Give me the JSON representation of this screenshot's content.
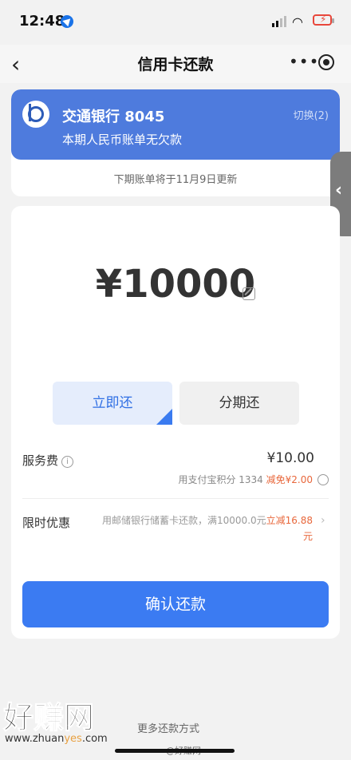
{
  "status": {
    "time": "12:48"
  },
  "nav": {
    "title": "信用卡还款",
    "more": "•••"
  },
  "card": {
    "bank_name": "交通银行 8045",
    "desc": "本期人民币账单无欠款",
    "switch": "切换(2)",
    "update_note": "下期账单将于11月9日更新"
  },
  "payment": {
    "amount": "¥10000",
    "option_now": "立即还",
    "option_installment": "分期还",
    "fee_label": "服务费",
    "fee_value": "¥10.00",
    "points_text": "用支付宝积分 1334",
    "points_discount": "减免¥2.00",
    "promo_label": "限时优惠",
    "promo_text": "用邮储银行储蓄卡还款，满10000.0元",
    "promo_discount": "立减16.88元",
    "confirm": "确认还款"
  },
  "footer": {
    "more_ways": "更多还款方式",
    "watermark_cn": "好赚网",
    "watermark_en_1": "www.zhuan",
    "watermark_en_2": "yes",
    "watermark_en_3": ".com",
    "weibo": "@好赚网"
  },
  "colors": {
    "accent": "#3b7bf2",
    "bank_bg": "#4e7bdd",
    "discount": "#e8673b"
  }
}
